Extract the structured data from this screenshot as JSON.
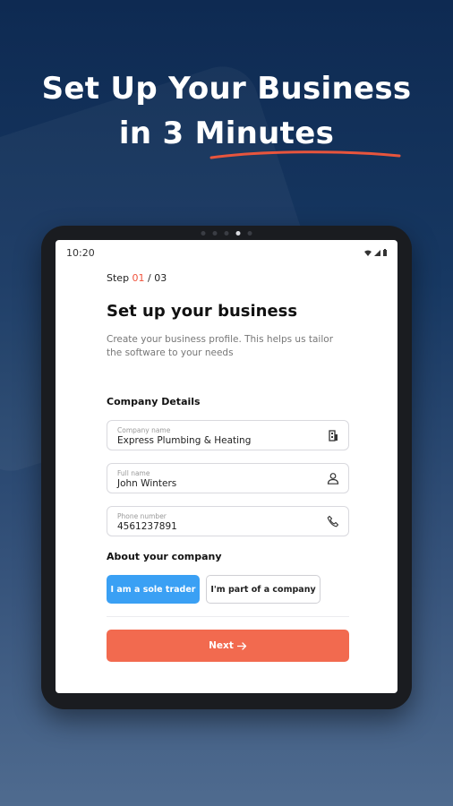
{
  "hero": {
    "line1": "Set Up Your Business",
    "line2": "in 3 Minutes",
    "accent_color": "#e8553d"
  },
  "statusbar": {
    "time": "10:20",
    "icons": [
      "wifi-icon",
      "signal-icon",
      "battery-icon"
    ]
  },
  "form": {
    "step_prefix": "Step ",
    "step_current": "01",
    "step_sep": " / ",
    "step_total": "03",
    "title": "Set up your business",
    "subtitle": "Create your business profile. This helps us tailor the software to your needs",
    "company_section": "Company Details",
    "fields": [
      {
        "label": "Company name",
        "value": "Express Plumbing & Heating",
        "icon": "building-icon"
      },
      {
        "label": "Full name",
        "value": "John Winters",
        "icon": "person-icon"
      },
      {
        "label": "Phone number",
        "value": "4561237891",
        "icon": "phone-icon"
      }
    ],
    "about_section": "About your company",
    "choices": [
      {
        "label": "I am a sole trader",
        "selected": true
      },
      {
        "label": "I'm part of a company",
        "selected": false
      }
    ],
    "next_label": "Next",
    "next_icon": "arrow-right-icon",
    "colors": {
      "primary": "#f26a4f",
      "selected": "#3aa0f4",
      "step_current": "#f0533c"
    }
  }
}
